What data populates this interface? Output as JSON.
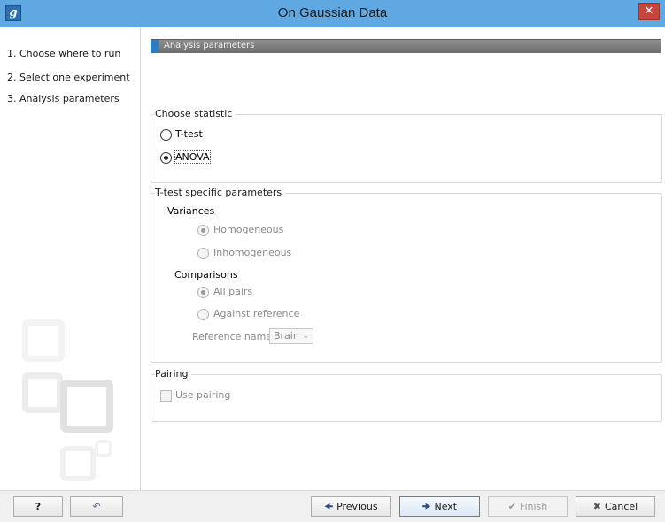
{
  "window": {
    "app_icon": "g",
    "title": "On Gaussian Data",
    "close_glyph": "✕"
  },
  "steps": [
    {
      "num": "1.",
      "label": "Choose where to run"
    },
    {
      "num": "2.",
      "label": "Select one experiment"
    },
    {
      "num": "3.",
      "label": "Analysis parameters"
    }
  ],
  "section": {
    "title": "Analysis parameters"
  },
  "choose_statistic": {
    "title": "Choose statistic",
    "options": [
      {
        "label": "T-test",
        "selected": false
      },
      {
        "label": "ANOVA",
        "selected": true
      }
    ]
  },
  "ttest_params": {
    "title": "T-test specific parameters",
    "variances_label": "Variances",
    "variances": [
      {
        "label": "Homogeneous",
        "selected": true
      },
      {
        "label": "Inhomogeneous",
        "selected": false
      }
    ],
    "comparisons_label": "Comparisons",
    "comparisons": [
      {
        "label": "All pairs",
        "selected": true
      },
      {
        "label": "Against reference",
        "selected": false
      }
    ],
    "reference_label": "Reference name",
    "reference_value": "Brain"
  },
  "pairing": {
    "title": "Pairing",
    "use_pairing_label": "Use pairing",
    "use_pairing_checked": false
  },
  "footer": {
    "help_label": "?",
    "reset_glyph": "↶",
    "previous_label": "Previous",
    "next_label": "Next",
    "finish_label": "Finish",
    "cancel_label": "Cancel"
  },
  "colors": {
    "titlebar": "#5fa8e2",
    "section_head": "#7a7a7a",
    "accent": "#2c7dc1",
    "close": "#c8453c"
  }
}
